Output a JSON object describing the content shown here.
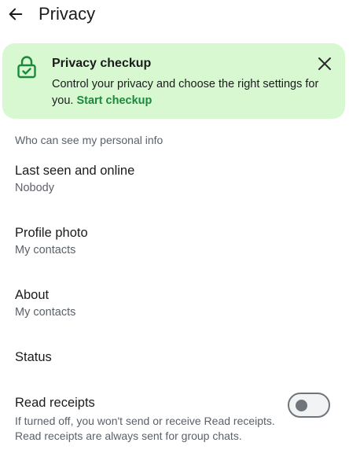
{
  "header": {
    "title": "Privacy",
    "back_icon": "arrow-left-icon"
  },
  "banner": {
    "title": "Privacy checkup",
    "text": "Control your privacy and choose the right settings for you.",
    "link": "Start checkup",
    "icon": "lock-check-icon",
    "close_icon": "close-icon",
    "background": "#d8f8d2",
    "accent": "#1a8a3a"
  },
  "section": {
    "header": "Who can see my personal info"
  },
  "settings": [
    {
      "title": "Last seen and online",
      "value": "Nobody"
    },
    {
      "title": "Profile photo",
      "value": "My contacts"
    },
    {
      "title": "About",
      "value": "My contacts"
    },
    {
      "title": "Status"
    }
  ],
  "read_receipts": {
    "title": "Read receipts",
    "description": "If turned off, you won't send or receive Read receipts. Read receipts are always sent for group chats.",
    "enabled": false
  }
}
